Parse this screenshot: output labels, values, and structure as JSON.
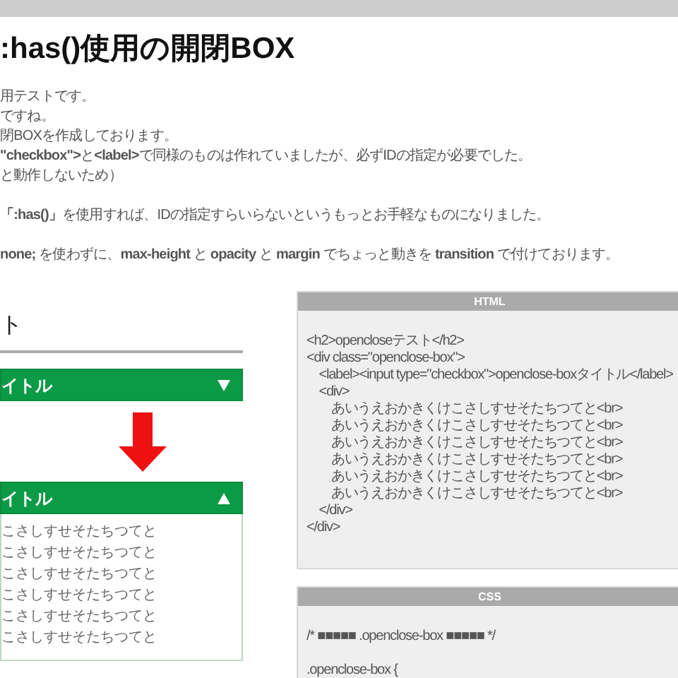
{
  "title": ":has()使用の開閉BOX",
  "paragraphs": [
    {
      "lines": [
        "用テストです。",
        "ですね。",
        "閉BOXを作成しております。",
        "**\"checkbox\">**と**<label>**で同様のものは作れていましたが、必ずIDの指定が必要でした。",
        "と動作しないため）"
      ]
    },
    {
      "lines": [
        "**「:has()」**を使用すれば、IDの指定すらいらないというもっとお手軽なものになりました。"
      ]
    },
    {
      "lines": [
        "**none;** を使わずに、**max-height** と **opacity** と **margin** でちょっと動きを **transition** で付けております。"
      ]
    }
  ],
  "demo": {
    "heading": "ト",
    "boxes": [
      {
        "title": "イトル",
        "expanded": false
      },
      {
        "title": "イトル",
        "expanded": true,
        "lines": [
          "こさしすせそたちつてと",
          "こさしすせそたちつてと",
          "こさしすせそたちつてと",
          "こさしすせそたちつてと",
          "こさしすせそたちつてと",
          "こさしすせそたちつてと"
        ]
      }
    ]
  },
  "code_panels": [
    {
      "title": "HTML",
      "blocks": [
        [
          "<h2>opencloseテスト</h2>",
          "<div class=\"openclose-box\">",
          "    <label><input type=\"checkbox\">openclose-boxタイトル</label>",
          "    <div>",
          "        あいうえおかきくけこさしすせそたちつてと<br>",
          "        あいうえおかきくけこさしすせそたちつてと<br>",
          "        あいうえおかきくけこさしすせそたちつてと<br>",
          "        あいうえおかきくけこさしすせそたちつてと<br>",
          "        あいうえおかきくけこさしすせそたちつてと<br>",
          "        あいうえおかきくけこさしすせそたちつてと<br>",
          "    </div>",
          "</div>"
        ]
      ]
    },
    {
      "title": "CSS",
      "blocks": [
        [
          "/* ■■■■■ .openclose-box ■■■■■ */"
        ],
        [
          ".openclose-box {"
        ]
      ]
    }
  ]
}
